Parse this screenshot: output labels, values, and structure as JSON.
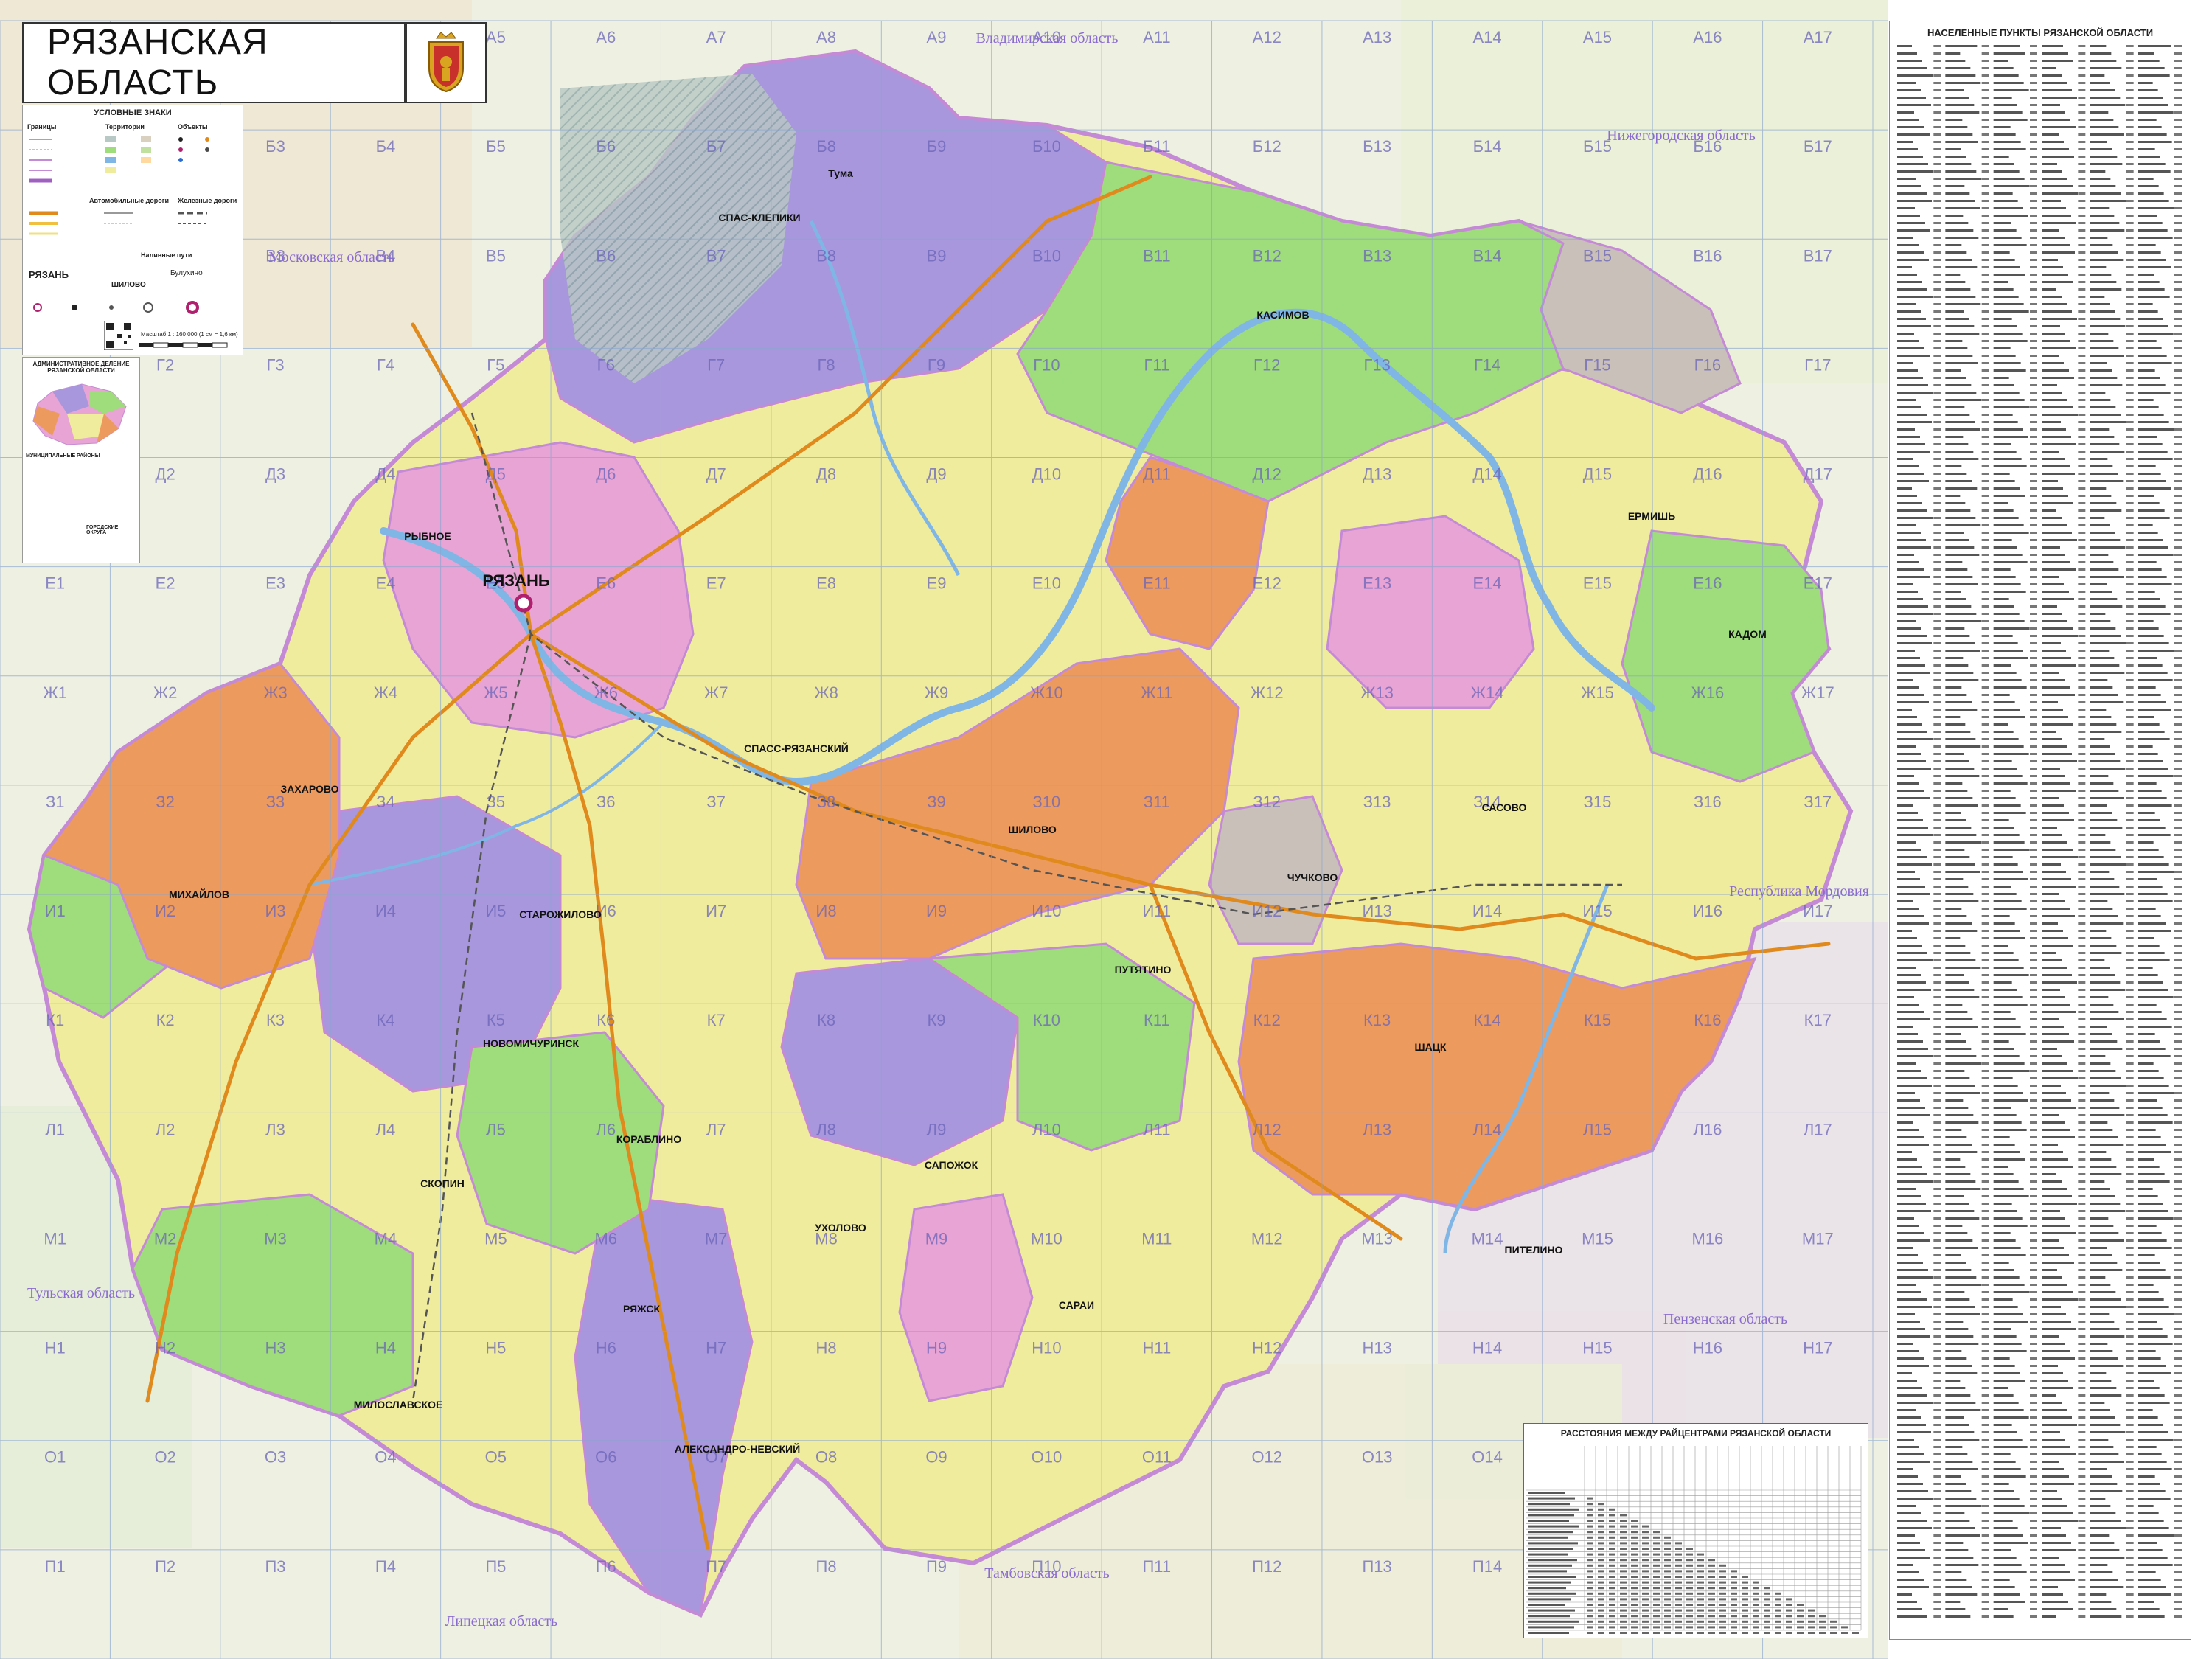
{
  "title": "РЯЗАНСКАЯ ОБЛАСТЬ",
  "legend": {
    "heading": "УСЛОВНЫЕ ЗНАКИ",
    "borders_heading": "Границы",
    "territory_heading": "Территории",
    "objects_heading": "Объекты",
    "roads_heading": "Автомобильные дороги",
    "rail_heading": "Железные дороги",
    "ferry_heading": "Наливные пути",
    "rayzan_label": "РЯЗАНЬ",
    "shilovo_label": "ШИЛОВО",
    "bulukhino_label": "Булухино",
    "scale_label": "Масштаб 1 : 160 000  (1 см = 1,6 км)"
  },
  "admin_inset": {
    "heading": "АДМИНИСТРАТИВНОЕ ДЕЛЕНИЕ РЯЗАНСКОЙ ОБЛАСТИ",
    "districts_heading": "МУНИЦИПАЛЬНЫЕ РАЙОНЫ",
    "cities_heading": "ГОРОДСКИЕ ОКРУГА"
  },
  "right_panel": {
    "heading": "НАСЕЛЕННЫЕ ПУНКТЫ РЯЗАНСКОЙ ОБЛАСТИ"
  },
  "distance_table": {
    "heading": "РАССТОЯНИЯ МЕЖДУ РАЙЦЕНТРАМИ РЯЗАНСКОЙ ОБЛАСТИ"
  },
  "grid": {
    "columns": [
      "1",
      "2",
      "3",
      "4",
      "5",
      "6",
      "7",
      "8",
      "9",
      "10",
      "11",
      "12",
      "13",
      "14",
      "15",
      "16",
      "17"
    ],
    "rows": [
      "А",
      "Б",
      "В",
      "Г",
      "Д",
      "Е",
      "Ж",
      "З",
      "И",
      "К",
      "Л",
      "М",
      "Н",
      "О",
      "П"
    ]
  },
  "neighbor_regions": [
    {
      "id": "vladimir",
      "name": "Владимирская область"
    },
    {
      "id": "nizhny",
      "name": "Нижегородская область"
    },
    {
      "id": "moscow",
      "name": "Московская область"
    },
    {
      "id": "mordovia",
      "name": "Республика Мордовия"
    },
    {
      "id": "tula",
      "name": "Тульская область"
    },
    {
      "id": "penza",
      "name": "Пензенская область"
    },
    {
      "id": "tambov",
      "name": "Тамбовская область"
    },
    {
      "id": "lipetsk",
      "name": "Липецкая область"
    }
  ],
  "cities": [
    {
      "id": "ryazan",
      "name": "РЯЗАНЬ",
      "capital": true
    },
    {
      "id": "kasimov",
      "name": "КАСИМОВ"
    },
    {
      "id": "skopin",
      "name": "СКОПИН"
    },
    {
      "id": "sasovo",
      "name": "САСОВО"
    },
    {
      "id": "shilovo",
      "name": "ШИЛОВО"
    },
    {
      "id": "rybnoe",
      "name": "РЫБНОЕ"
    },
    {
      "id": "spassk",
      "name": "СПАСС-РЯЗАНСКИЙ"
    },
    {
      "id": "mikhailov",
      "name": "МИХАЙЛОВ"
    },
    {
      "id": "novomichurinsk",
      "name": "НОВОМИЧУРИНСК"
    },
    {
      "id": "korablino",
      "name": "КОРАБЛИНО"
    },
    {
      "id": "ryazhsk",
      "name": "РЯЖСК"
    },
    {
      "id": "sapozhok",
      "name": "САПОЖОК"
    },
    {
      "id": "sarai",
      "name": "САРАИ"
    },
    {
      "id": "shatsk",
      "name": "ШАЦК"
    },
    {
      "id": "kadom",
      "name": "КАДОМ"
    },
    {
      "id": "ermishi",
      "name": "ЕРМИШЬ"
    },
    {
      "id": "putyatino",
      "name": "ПУТЯТИНО"
    },
    {
      "id": "chuchkovo",
      "name": "ЧУЧКОВО"
    },
    {
      "id": "miloslavskoe",
      "name": "МИЛОСЛАВСКОЕ"
    },
    {
      "id": "aleksandro",
      "name": "АЛЕКСАНДРО-НЕВСКИЙ"
    },
    {
      "id": "ukholovo",
      "name": "УХОЛОВО"
    },
    {
      "id": "pitelino",
      "name": "ПИТЕЛИНО"
    },
    {
      "id": "starozhilovo",
      "name": "СТАРОЖИЛОВО"
    },
    {
      "id": "zakharovo",
      "name": "ЗАХАРОВО"
    },
    {
      "id": "tuma",
      "name": "Тума"
    },
    {
      "id": "spas_klepiki",
      "name": "СПАС-КЛЕПИКИ"
    }
  ],
  "colors": {
    "water": "#7fb6e6",
    "purple": "#a897dc",
    "green": "#9fdc7c",
    "orange": "#ec9a5e",
    "pink": "#e7a4d4",
    "yellow": "#f0ec9e",
    "gray": "#c9c0ba",
    "outside": "#eef0e2",
    "grid": "#8aa6d0",
    "region_border": "#c58ad6"
  }
}
